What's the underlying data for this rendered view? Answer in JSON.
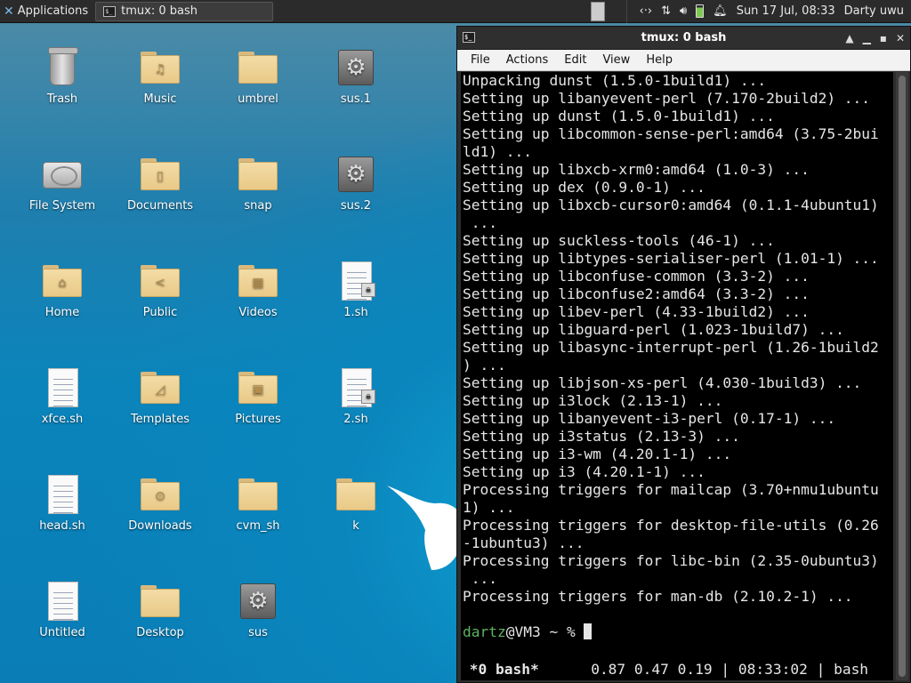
{
  "panel": {
    "apps_label": "Applications",
    "task_label": "tmux: 0 bash",
    "datetime": "Sun 17 Jul, 08:33",
    "user": "Darty uwu"
  },
  "desktop": {
    "icons": [
      {
        "label": "Trash",
        "kind": "trash"
      },
      {
        "label": "Music",
        "kind": "folder",
        "emblem": "♫"
      },
      {
        "label": "umbrel",
        "kind": "folder",
        "emblem": ""
      },
      {
        "label": "sus.1",
        "kind": "exec"
      },
      {
        "label": "File System",
        "kind": "drive"
      },
      {
        "label": "Documents",
        "kind": "folder",
        "emblem": "▯"
      },
      {
        "label": "snap",
        "kind": "folder",
        "emblem": ""
      },
      {
        "label": "sus.2",
        "kind": "exec"
      },
      {
        "label": "Home",
        "kind": "folder",
        "emblem": "⌂"
      },
      {
        "label": "Public",
        "kind": "folder",
        "emblem": "<"
      },
      {
        "label": "Videos",
        "kind": "folder",
        "emblem": "▦"
      },
      {
        "label": "1.sh",
        "kind": "script-locked"
      },
      {
        "label": "xfce.sh",
        "kind": "script"
      },
      {
        "label": "Templates",
        "kind": "folder",
        "emblem": "◿"
      },
      {
        "label": "Pictures",
        "kind": "folder",
        "emblem": "▣"
      },
      {
        "label": "2.sh",
        "kind": "script-locked"
      },
      {
        "label": "head.sh",
        "kind": "script"
      },
      {
        "label": "Downloads",
        "kind": "folder",
        "emblem": "⊙"
      },
      {
        "label": "cvm_sh",
        "kind": "folder",
        "emblem": ""
      },
      {
        "label": "k",
        "kind": "folder",
        "emblem": ""
      },
      {
        "label": "Untitled",
        "kind": "doc"
      },
      {
        "label": "Desktop",
        "kind": "folder",
        "emblem": ""
      },
      {
        "label": "sus",
        "kind": "exec"
      }
    ]
  },
  "terminal": {
    "title": "tmux: 0 bash",
    "menu": [
      "File",
      "Actions",
      "Edit",
      "View",
      "Help"
    ],
    "lines": [
      "Unpacking dunst (1.5.0-1build1) ...",
      "Setting up libanyevent-perl (7.170-2build2) ...",
      "Setting up dunst (1.5.0-1build1) ...",
      "Setting up libcommon-sense-perl:amd64 (3.75-2bui",
      "ld1) ...",
      "Setting up libxcb-xrm0:amd64 (1.0-3) ...",
      "Setting up dex (0.9.0-1) ...",
      "Setting up libxcb-cursor0:amd64 (0.1.1-4ubuntu1)",
      " ...",
      "Setting up suckless-tools (46-1) ...",
      "Setting up libtypes-serialiser-perl (1.01-1) ...",
      "Setting up libconfuse-common (3.3-2) ...",
      "Setting up libconfuse2:amd64 (3.3-2) ...",
      "Setting up libev-perl (4.33-1build2) ...",
      "Setting up libguard-perl (1.023-1build7) ...",
      "Setting up libasync-interrupt-perl (1.26-1build2",
      ") ...",
      "Setting up libjson-xs-perl (4.030-1build3) ...",
      "Setting up i3lock (2.13-1) ...",
      "Setting up libanyevent-i3-perl (0.17-1) ...",
      "Setting up i3status (2.13-3) ...",
      "Setting up i3-wm (4.20.1-1) ...",
      "Setting up i3 (4.20.1-1) ...",
      "Processing triggers for mailcap (3.70+nmu1ubuntu",
      "1) ...",
      "Processing triggers for desktop-file-utils (0.26",
      "-1ubuntu3) ...",
      "Processing triggers for libc-bin (2.35-0ubuntu3)",
      " ...",
      "Processing triggers for man-db (2.10.2-1) ...",
      ""
    ],
    "prompt_user": "dartz",
    "prompt_rest": "@VM3 ~ % ",
    "status_window": "*0 bash*",
    "status_info": "      0.87 0.47 0.19 | 08:33:02 | bash"
  }
}
